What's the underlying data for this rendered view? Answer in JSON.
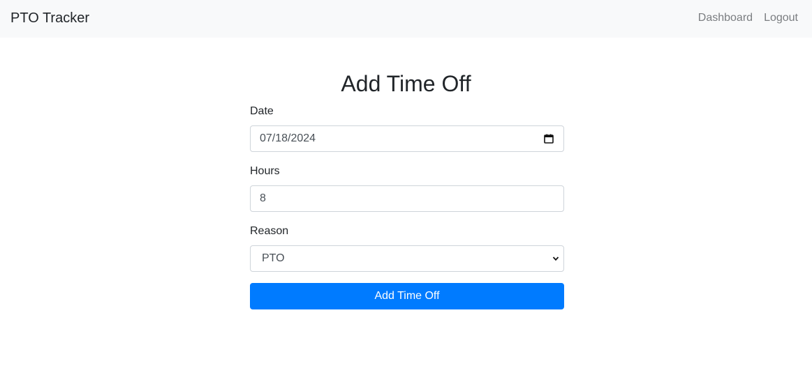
{
  "navbar": {
    "brand": "PTO Tracker",
    "links": [
      "Dashboard",
      "Logout"
    ]
  },
  "main": {
    "title": "Add Time Off",
    "form": {
      "date": {
        "label": "Date",
        "value": "07/18/2024"
      },
      "hours": {
        "label": "Hours",
        "value": "8"
      },
      "reason": {
        "label": "Reason",
        "selected": "PTO"
      },
      "submit_label": "Add Time Off"
    }
  },
  "colors": {
    "navbar_bg": "#f8f9fa",
    "primary": "#007bff",
    "nav_link": "#7a7d80",
    "text": "#212529"
  },
  "icons": {
    "date_picker": "calendar-icon",
    "select": "chevron-down-icon"
  }
}
